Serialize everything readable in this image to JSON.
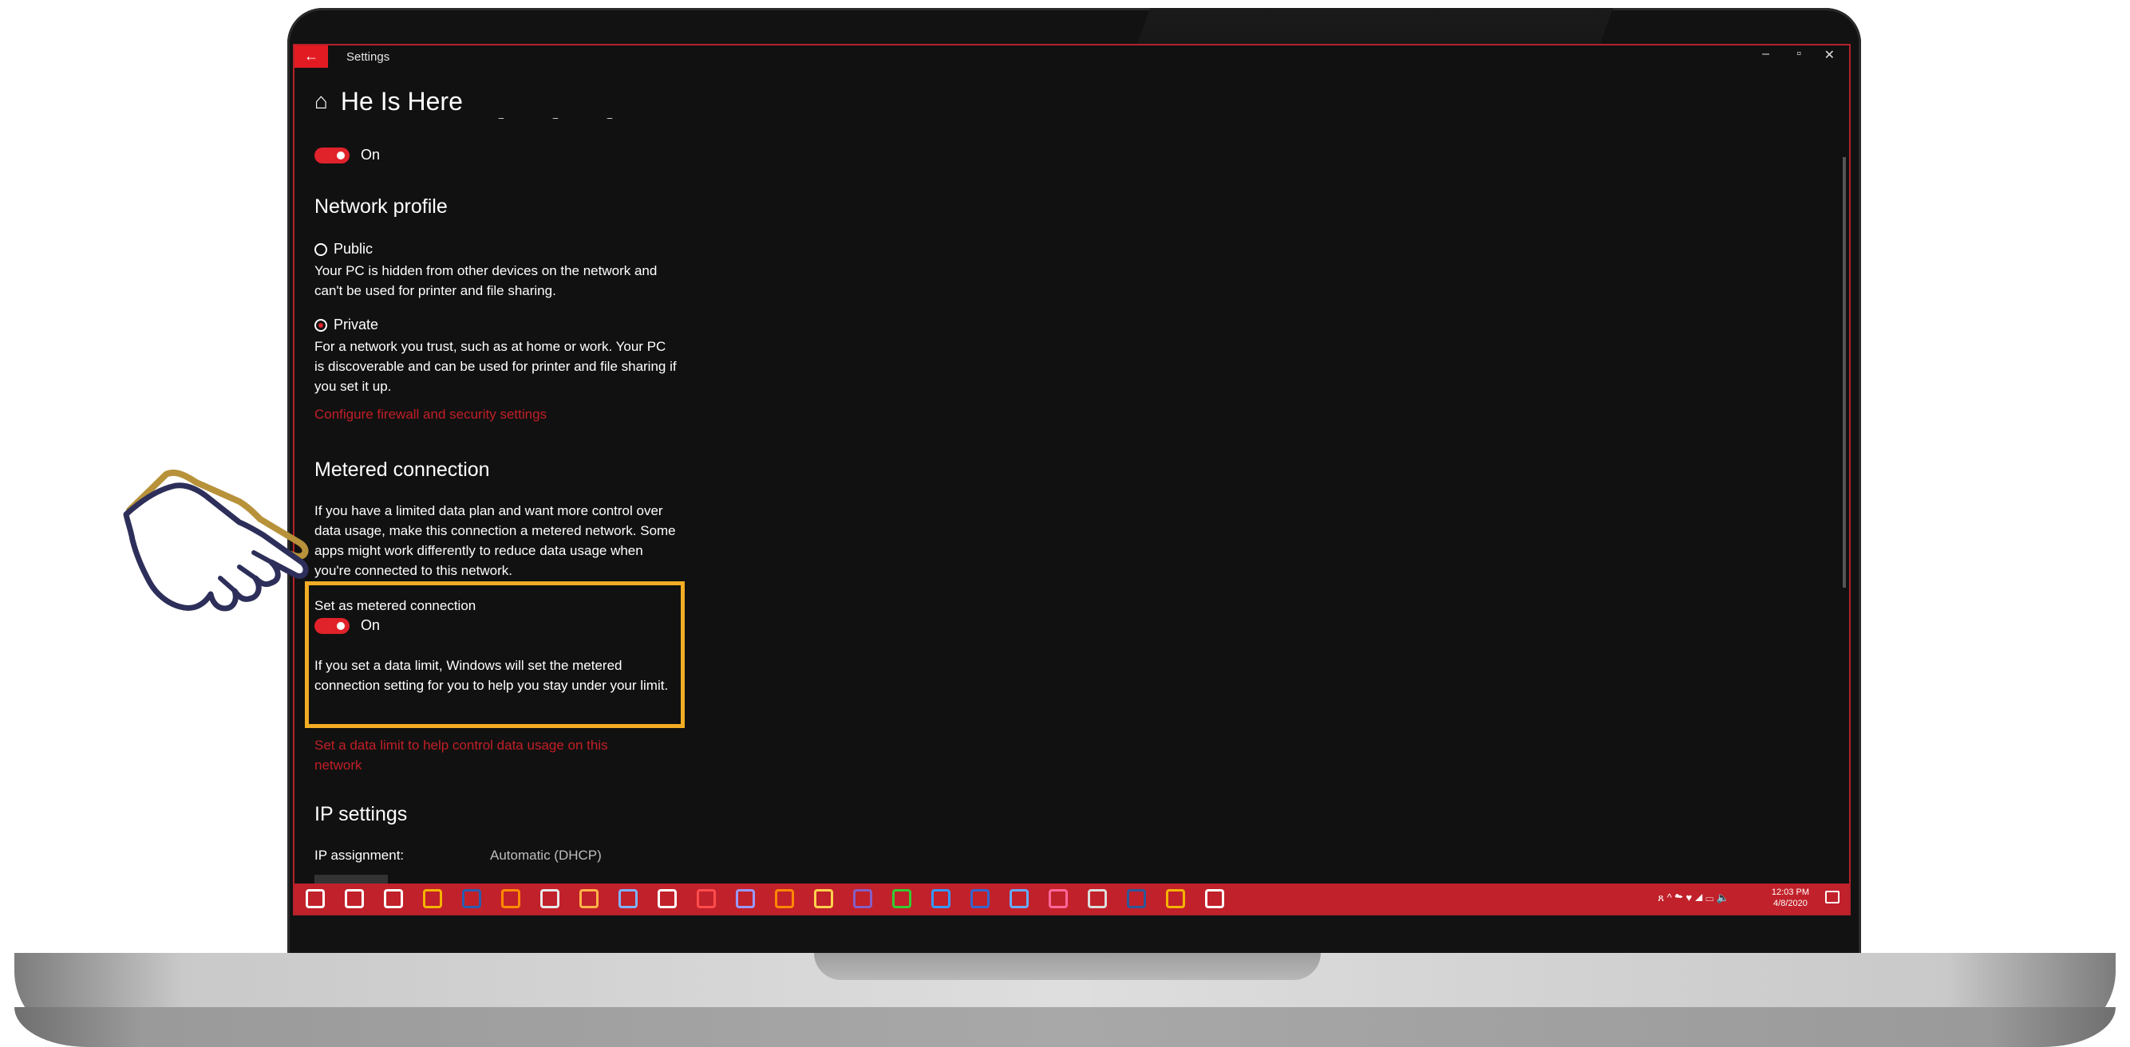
{
  "window": {
    "app_title": "Settings",
    "back_icon": "←",
    "minimize_icon": "–",
    "restore_icon": "▫",
    "close_icon": "✕"
  },
  "page": {
    "title": "He Is Here",
    "home_icon": "⌂"
  },
  "top_toggle": {
    "state_label": "On"
  },
  "network_profile": {
    "heading": "Network profile",
    "public_label": "Public",
    "public_desc": "Your PC is hidden from other devices on the network and can't be used for printer and file sharing.",
    "private_label": "Private",
    "private_desc": "For a network you trust, such as at home or work. Your PC is discoverable and can be used for printer and file sharing if you set it up.",
    "selected": "Private",
    "firewall_link": "Configure firewall and security settings"
  },
  "metered": {
    "heading": "Metered connection",
    "desc": "If you have a limited data plan and want more control over data usage, make this connection a metered network. Some apps might work differently to reduce data usage when you're connected to this network.",
    "toggle_title": "Set as metered connection",
    "toggle_state": "On",
    "limit_desc": "If you set a data limit, Windows will set the metered connection setting for you to help you stay under your limit.",
    "data_limit_link": "Set a data limit to help control data usage on this network"
  },
  "ip_settings": {
    "heading": "IP settings",
    "assignment_label": "IP assignment:",
    "assignment_value": "Automatic (DHCP)"
  },
  "taskbar": {
    "clock_time": "12:03 PM",
    "clock_date": "4/8/2020",
    "tray_icons": [
      "people-icon",
      "chevron-up-icon",
      "network-icon",
      "shield-icon",
      "wifi-icon",
      "battery-icon",
      "volume-icon"
    ],
    "tray_text": "ጸ ^ ☁ ♥ ◢ ▭ 🔈",
    "app_icons": [
      {
        "name": "windows-start-icon",
        "color": "#ffffff"
      },
      {
        "name": "search-icon",
        "color": "#ffffff"
      },
      {
        "name": "task-view-icon",
        "color": "#ffffff"
      },
      {
        "name": "chrome-icon",
        "color": "#f4b400"
      },
      {
        "name": "photoshop-icon",
        "color": "#2a5db0"
      },
      {
        "name": "illustrator-icon",
        "color": "#ff8c00"
      },
      {
        "name": "app-icon",
        "color": "#e8e8e8"
      },
      {
        "name": "app-icon",
        "color": "#ffb347"
      },
      {
        "name": "app-icon",
        "color": "#7fb2ff"
      },
      {
        "name": "app-icon",
        "color": "#ffffff"
      },
      {
        "name": "app-icon",
        "color": "#ff4d4d"
      },
      {
        "name": "premiere-icon",
        "color": "#9999ff"
      },
      {
        "name": "vlc-icon",
        "color": "#ff8800"
      },
      {
        "name": "file-explorer-icon",
        "color": "#ffd24d"
      },
      {
        "name": "visual-studio-icon",
        "color": "#865fc5"
      },
      {
        "name": "media-player-icon",
        "color": "#33cc33"
      },
      {
        "name": "app-icon",
        "color": "#3399ff"
      },
      {
        "name": "app-icon",
        "color": "#3366cc"
      },
      {
        "name": "app-icon",
        "color": "#66aaff"
      },
      {
        "name": "app-icon",
        "color": "#ff6699"
      },
      {
        "name": "app-icon",
        "color": "#dddddd"
      },
      {
        "name": "word-icon",
        "color": "#2b579a"
      },
      {
        "name": "chrome-icon",
        "color": "#f4b400"
      },
      {
        "name": "settings-gear-icon",
        "color": "#ffffff"
      }
    ]
  },
  "colors": {
    "accent": "#e0222b",
    "highlight_box": "#f3ad24",
    "background": "#111111",
    "hand_outline": "#2d2f5a",
    "hand_shadow": "#b8923a"
  }
}
